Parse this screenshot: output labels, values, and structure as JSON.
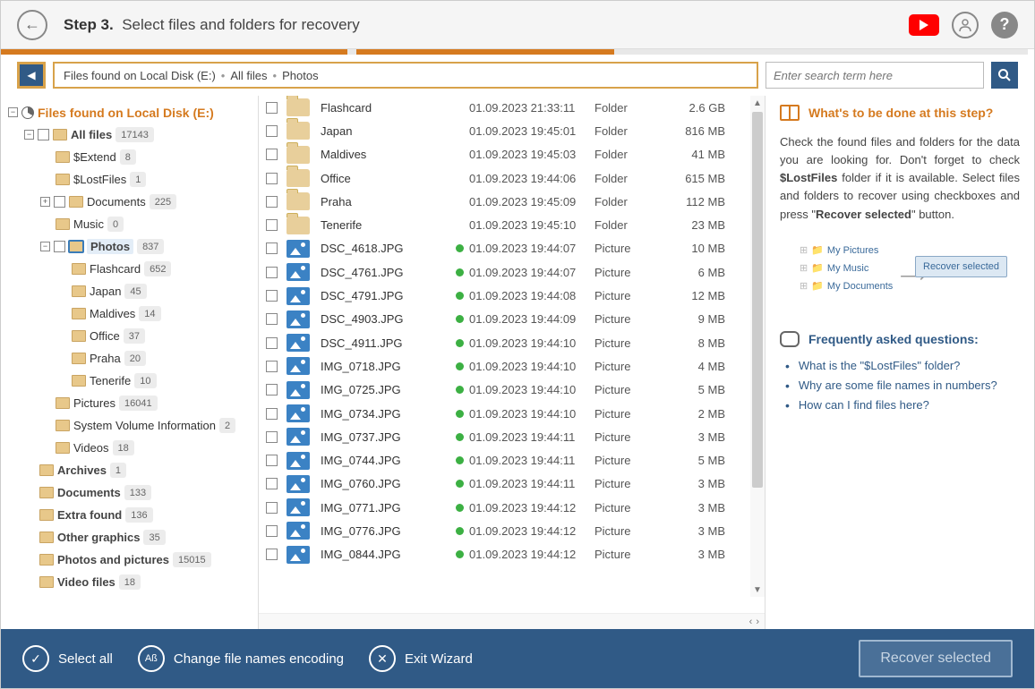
{
  "header": {
    "step_label": "Step 3.",
    "step_text": "Select files and folders for recovery"
  },
  "breadcrumb": {
    "part1": "Files found on Local Disk (E:)",
    "part2": "All files",
    "part3": "Photos"
  },
  "search": {
    "placeholder": "Enter search term here"
  },
  "tree": {
    "root": "Files found on Local Disk (E:)",
    "allfiles_label": "All files",
    "allfiles_count": "17143",
    "extend_label": "$Extend",
    "extend_count": "8",
    "lostfiles_label": "$LostFiles",
    "lostfiles_count": "1",
    "docs_label": "Documents",
    "docs_count": "225",
    "music_label": "Music",
    "music_count": "0",
    "photos_label": "Photos",
    "photos_count": "837",
    "flashcard_label": "Flashcard",
    "flashcard_count": "652",
    "japan_label": "Japan",
    "japan_count": "45",
    "maldives_label": "Maldives",
    "maldives_count": "14",
    "office_label": "Office",
    "office_count": "37",
    "praha_label": "Praha",
    "praha_count": "20",
    "tenerife_label": "Tenerife",
    "tenerife_count": "10",
    "pictures_label": "Pictures",
    "pictures_count": "16041",
    "svi_label": "System Volume Information",
    "svi_count": "2",
    "videos_label": "Videos",
    "videos_count": "18",
    "archives_label": "Archives",
    "archives_count": "1",
    "docs2_label": "Documents",
    "docs2_count": "133",
    "extra_label": "Extra found",
    "extra_count": "136",
    "othergfx_label": "Other graphics",
    "othergfx_count": "35",
    "pp_label": "Photos and pictures",
    "pp_count": "15015",
    "vf_label": "Video files",
    "vf_count": "18"
  },
  "files": [
    {
      "name": "Flashcard",
      "date": "01.09.2023 21:33:11",
      "type": "Folder",
      "size": "2.6 GB",
      "kind": "folder"
    },
    {
      "name": "Japan",
      "date": "01.09.2023 19:45:01",
      "type": "Folder",
      "size": "816 MB",
      "kind": "folder"
    },
    {
      "name": "Maldives",
      "date": "01.09.2023 19:45:03",
      "type": "Folder",
      "size": "41 MB",
      "kind": "folder"
    },
    {
      "name": "Office",
      "date": "01.09.2023 19:44:06",
      "type": "Folder",
      "size": "615 MB",
      "kind": "folder"
    },
    {
      "name": "Praha",
      "date": "01.09.2023 19:45:09",
      "type": "Folder",
      "size": "112 MB",
      "kind": "folder"
    },
    {
      "name": "Tenerife",
      "date": "01.09.2023 19:45:10",
      "type": "Folder",
      "size": "23 MB",
      "kind": "folder"
    },
    {
      "name": "DSC_4618.JPG",
      "date": "01.09.2023 19:44:07",
      "type": "Picture",
      "size": "10 MB",
      "kind": "pic"
    },
    {
      "name": "DSC_4761.JPG",
      "date": "01.09.2023 19:44:07",
      "type": "Picture",
      "size": "6 MB",
      "kind": "pic"
    },
    {
      "name": "DSC_4791.JPG",
      "date": "01.09.2023 19:44:08",
      "type": "Picture",
      "size": "12 MB",
      "kind": "pic"
    },
    {
      "name": "DSC_4903.JPG",
      "date": "01.09.2023 19:44:09",
      "type": "Picture",
      "size": "9 MB",
      "kind": "pic"
    },
    {
      "name": "DSC_4911.JPG",
      "date": "01.09.2023 19:44:10",
      "type": "Picture",
      "size": "8 MB",
      "kind": "pic"
    },
    {
      "name": "IMG_0718.JPG",
      "date": "01.09.2023 19:44:10",
      "type": "Picture",
      "size": "4 MB",
      "kind": "pic"
    },
    {
      "name": "IMG_0725.JPG",
      "date": "01.09.2023 19:44:10",
      "type": "Picture",
      "size": "5 MB",
      "kind": "pic"
    },
    {
      "name": "IMG_0734.JPG",
      "date": "01.09.2023 19:44:10",
      "type": "Picture",
      "size": "2 MB",
      "kind": "pic"
    },
    {
      "name": "IMG_0737.JPG",
      "date": "01.09.2023 19:44:11",
      "type": "Picture",
      "size": "3 MB",
      "kind": "pic"
    },
    {
      "name": "IMG_0744.JPG",
      "date": "01.09.2023 19:44:11",
      "type": "Picture",
      "size": "5 MB",
      "kind": "pic"
    },
    {
      "name": "IMG_0760.JPG",
      "date": "01.09.2023 19:44:11",
      "type": "Picture",
      "size": "3 MB",
      "kind": "pic"
    },
    {
      "name": "IMG_0771.JPG",
      "date": "01.09.2023 19:44:12",
      "type": "Picture",
      "size": "3 MB",
      "kind": "pic"
    },
    {
      "name": "IMG_0776.JPG",
      "date": "01.09.2023 19:44:12",
      "type": "Picture",
      "size": "3 MB",
      "kind": "pic"
    },
    {
      "name": "IMG_0844.JPG",
      "date": "01.09.2023 19:44:12",
      "type": "Picture",
      "size": "3 MB",
      "kind": "pic"
    }
  ],
  "help": {
    "title": "What's to be done at this step?",
    "p1a": "Check the found files and folders for the data you are looking for. Don't forget to check ",
    "p1b": "$LostFiles",
    "p1c": " folder if it is available. Select files and folders to recover using checkboxes and press \"",
    "p1d": "Recover selected",
    "p1e": "\" button.",
    "hint_items": [
      "My Pictures",
      "My Music",
      "My Documents"
    ],
    "hint_btn": "Recover selected",
    "faq_title": "Frequently asked questions:",
    "faq": [
      "What is the \"$LostFiles\" folder?",
      "Why are some file names in numbers?",
      "How can I find files here?"
    ]
  },
  "footer": {
    "select_all": "Select all",
    "encoding": "Change file names encoding",
    "exit": "Exit Wizard",
    "recover": "Recover selected"
  }
}
